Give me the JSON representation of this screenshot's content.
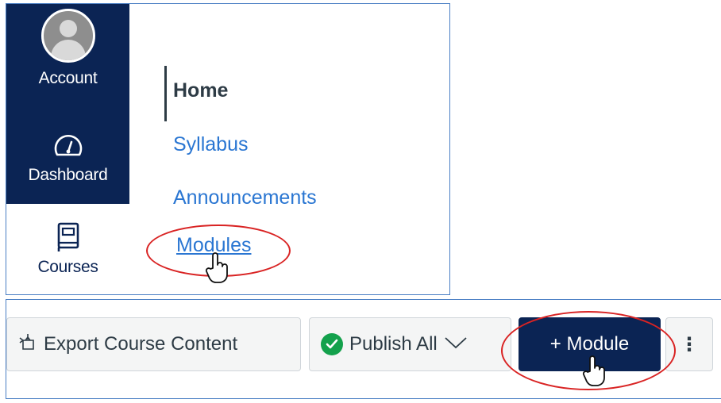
{
  "global_nav": {
    "account_label": "Account",
    "dashboard_label": "Dashboard",
    "courses_label": "Courses"
  },
  "course_nav": {
    "items": [
      {
        "label": "Home",
        "active": true
      },
      {
        "label": "Syllabus",
        "active": false
      },
      {
        "label": "Announcements",
        "active": false
      },
      {
        "label": "Modules",
        "active": false
      }
    ]
  },
  "toolbar": {
    "export_label": "Export Course Content",
    "publish_label": "Publish All",
    "module_label": "+ Module",
    "more_label": "⋮"
  },
  "icons": {
    "export": "export-icon",
    "publish_status": "check-circle-icon",
    "dropdown": "chevron-down-icon",
    "dashboard": "speedometer-icon",
    "courses": "book-icon",
    "cursor": "hand-pointer-icon"
  },
  "colors": {
    "nav_bg": "#0b2454",
    "link": "#2a76d2",
    "success": "#13a14c",
    "annotation": "#d92323",
    "panel_border": "#4a7fc4"
  }
}
